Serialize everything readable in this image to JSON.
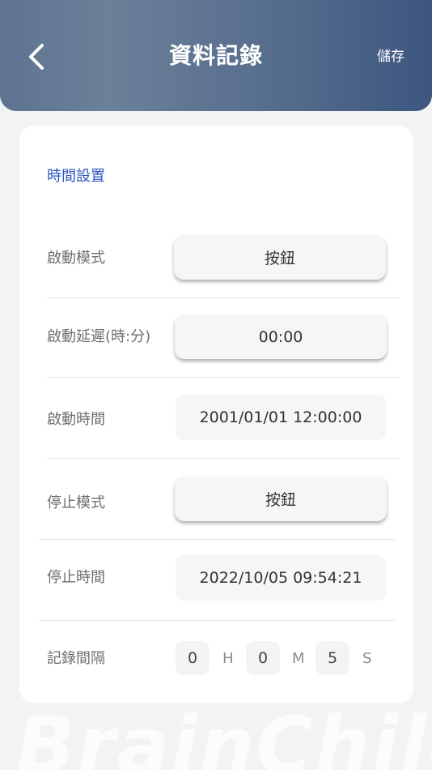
{
  "header": {
    "title": "資料記錄",
    "save_label": "儲存",
    "back_icon": "chevron-left-icon"
  },
  "section": {
    "title": "時間設置"
  },
  "rows": {
    "start_mode": {
      "label": "啟動模式",
      "value": "按鈕"
    },
    "start_delay": {
      "label": "啟動延遲(時:分)",
      "value": "00:00"
    },
    "start_time": {
      "label": "啟動時間",
      "value": "2001/01/01 12:00:00"
    },
    "stop_mode": {
      "label": "停止模式",
      "value": "按鈕"
    },
    "stop_time": {
      "label": "停止時間",
      "value": "2022/10/05 09:54:21"
    },
    "log_interval": {
      "label": "記錄間隔",
      "hours": "0",
      "hours_unit": "H",
      "minutes": "0",
      "minutes_unit": "M",
      "seconds": "5",
      "seconds_unit": "S"
    }
  },
  "watermark": "BrainChild",
  "colors": {
    "header_gradient_start": "#5d7390",
    "header_gradient_end": "#3c5680",
    "section_title": "#2f56c0",
    "background": "#f2f3f5"
  }
}
